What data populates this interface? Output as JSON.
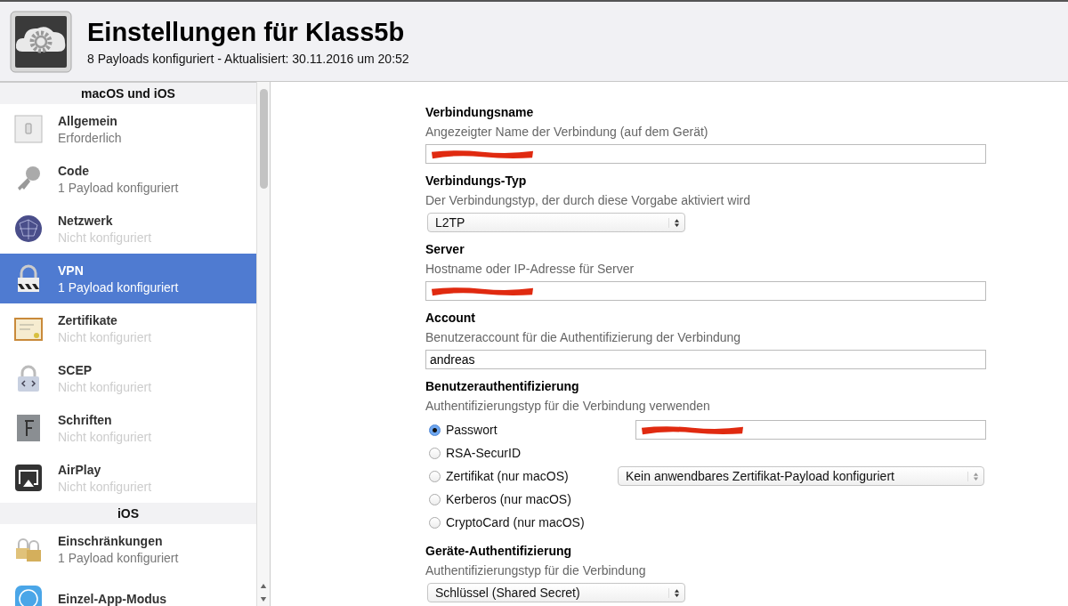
{
  "header": {
    "title": "Einstellungen für Klass5b",
    "subtitle": "8 Payloads konfiguriert - Aktualisiert: 30.11.2016 um 20:52"
  },
  "sidebar": {
    "sections": [
      {
        "title": "macOS und iOS",
        "items": [
          {
            "title": "Allgemein",
            "status": "Erforderlich",
            "configured": true,
            "selected": false
          },
          {
            "title": "Code",
            "status": "1 Payload konfiguriert",
            "configured": true,
            "selected": false
          },
          {
            "title": "Netzwerk",
            "status": "Nicht konfiguriert",
            "configured": false,
            "selected": false
          },
          {
            "title": "VPN",
            "status": "1 Payload konfiguriert",
            "configured": true,
            "selected": true
          },
          {
            "title": "Zertifikate",
            "status": "Nicht konfiguriert",
            "configured": false,
            "selected": false
          },
          {
            "title": "SCEP",
            "status": "Nicht konfiguriert",
            "configured": false,
            "selected": false
          },
          {
            "title": "Schriften",
            "status": "Nicht konfiguriert",
            "configured": false,
            "selected": false
          },
          {
            "title": "AirPlay",
            "status": "Nicht konfiguriert",
            "configured": false,
            "selected": false
          }
        ]
      },
      {
        "title": "iOS",
        "items": [
          {
            "title": "Einschränkungen",
            "status": "1 Payload konfiguriert",
            "configured": true,
            "selected": false
          },
          {
            "title": "Einzel-App-Modus",
            "selected": false
          }
        ]
      }
    ]
  },
  "form": {
    "fields": [
      {
        "kind": "text",
        "label": "Verbindungsname",
        "description": "Angezeigter Name der Verbindung (auf dem Gerät)",
        "redacted": true
      },
      {
        "kind": "select",
        "label": "Verbindungs-Typ",
        "description": "Der Verbindungstyp, der durch diese Vorgabe aktiviert wird",
        "value": "L2TP"
      },
      {
        "kind": "text",
        "label": "Server",
        "description": "Hostname oder IP-Adresse für Server",
        "redacted": true
      },
      {
        "kind": "text",
        "label": "Account",
        "description": "Benutzeraccount für die Authentifizierung der Verbindung",
        "value": "andreas",
        "redacted": false
      },
      {
        "kind": "radio",
        "label": "Benutzerauthentifizierung",
        "description": "Authentifizierungstyp für die Verbindung verwenden",
        "options": [
          {
            "label": "Passwort",
            "selected": true,
            "control": {
              "kind": "text",
              "redacted": true
            }
          },
          {
            "label": "RSA-SecurID",
            "selected": false
          },
          {
            "label": "Zertifikat (nur macOS)",
            "selected": false,
            "control": {
              "kind": "select",
              "value": "Kein anwendbares Zertifikat-Payload konfiguriert"
            }
          },
          {
            "label": "Kerberos (nur macOS)",
            "selected": false
          },
          {
            "label": "CryptoCard (nur macOS)",
            "selected": false
          }
        ]
      },
      {
        "kind": "select",
        "label": "Geräte-Authentifizierung",
        "description": "Authentifizierungstyp für die Verbindung",
        "value": "Schlüssel (Shared Secret)"
      }
    ]
  }
}
